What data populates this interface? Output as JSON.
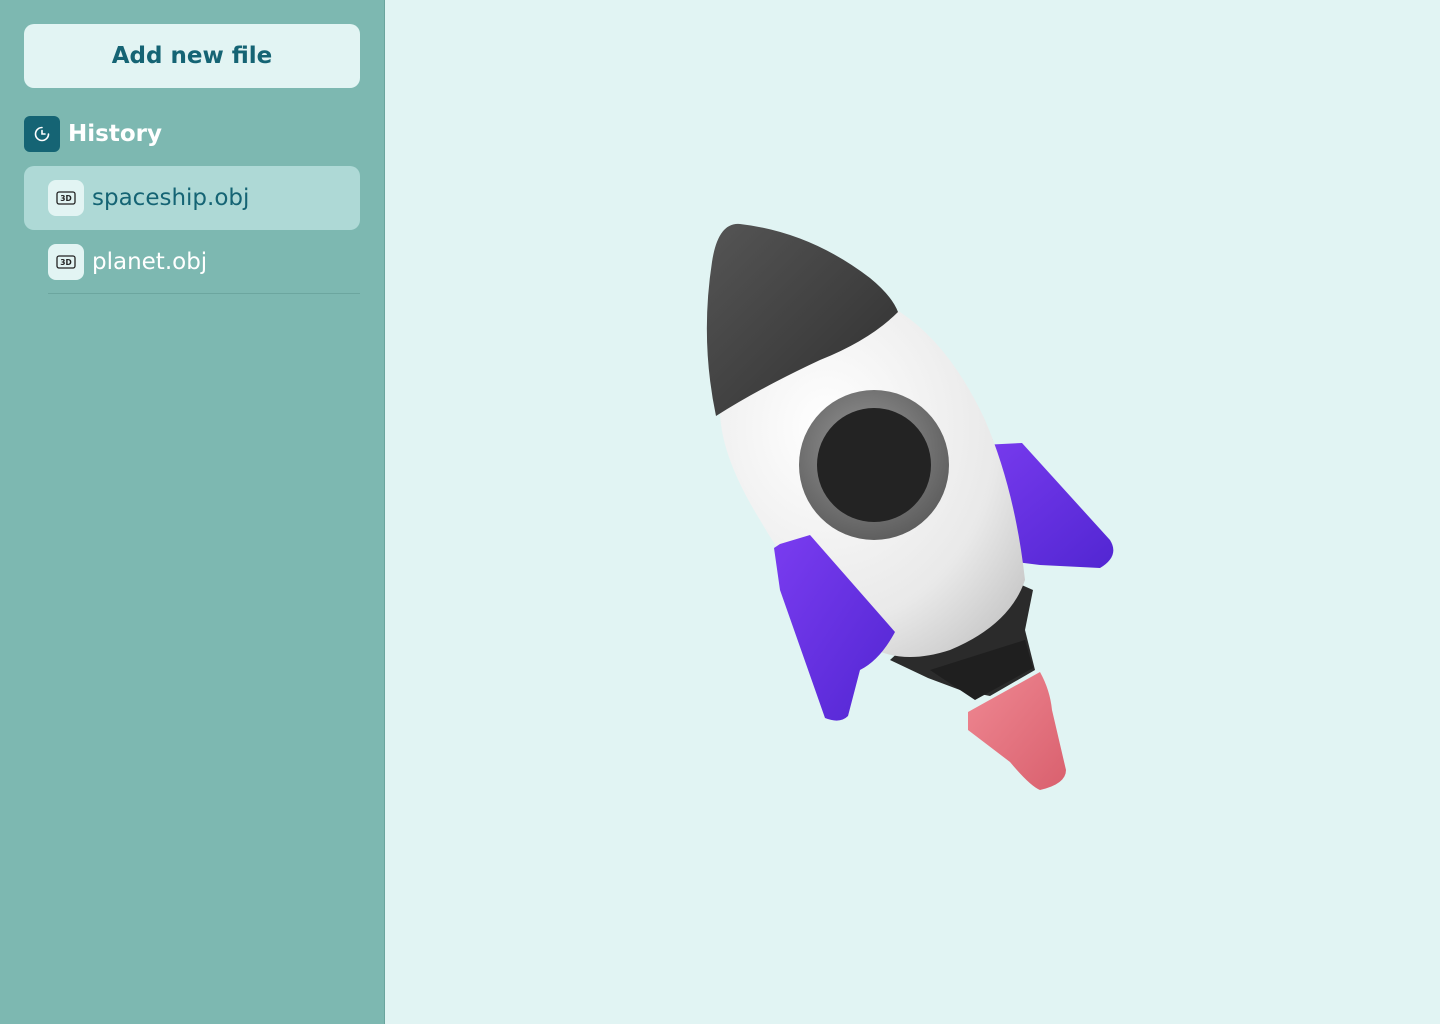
{
  "sidebar": {
    "add_button_label": "Add new file",
    "history_label": "History",
    "files": [
      {
        "name": "spaceship.obj",
        "icon": "3d-file-icon",
        "icon_text": "3D",
        "selected": true
      },
      {
        "name": "planet.obj",
        "icon": "3d-file-icon",
        "icon_text": "3D",
        "selected": false
      }
    ]
  },
  "viewer": {
    "model": "spaceship-3d-model"
  },
  "colors": {
    "sidebar_bg": "#7db8b1",
    "viewer_bg": "#e1f4f3",
    "accent": "#156474",
    "selected_item_bg": "#aed9d6",
    "rocket_fin": "#6a2ee6",
    "rocket_flame": "#e36c7a"
  }
}
